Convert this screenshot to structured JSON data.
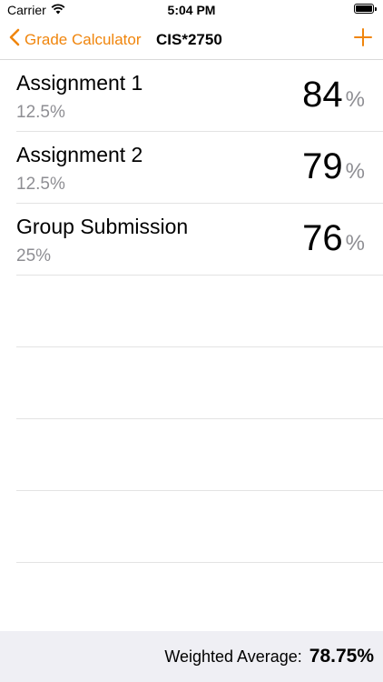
{
  "status_bar": {
    "carrier": "Carrier",
    "time": "5:04 PM"
  },
  "nav": {
    "back_label": "Grade Calculator",
    "title": "CIS*2750"
  },
  "items": [
    {
      "name": "Assignment 1",
      "weight": "12.5%",
      "grade": "84",
      "unit": "%"
    },
    {
      "name": "Assignment 2",
      "weight": "12.5%",
      "grade": "79",
      "unit": "%"
    },
    {
      "name": "Group Submission",
      "weight": "25%",
      "grade": "76",
      "unit": "%"
    }
  ],
  "footer": {
    "label": "Weighted Average:",
    "value": "78.75%"
  },
  "colors": {
    "accent": "#f0850c",
    "secondary_text": "#8e8e93",
    "footer_bg": "#efeff4"
  }
}
